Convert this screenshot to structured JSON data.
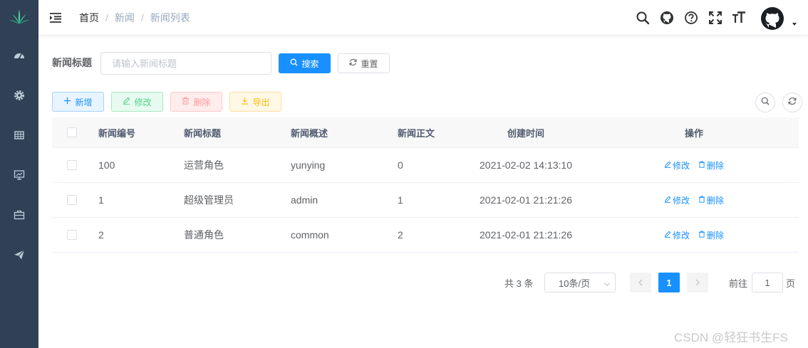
{
  "breadcrumb": [
    "首页",
    "新闻",
    "新闻列表"
  ],
  "search": {
    "label": "新闻标题",
    "placeholder": "请输入新闻标题",
    "search_label": "搜索",
    "reset_label": "重置"
  },
  "toolbar": {
    "add_label": "新增",
    "edit_label": "修改",
    "delete_label": "删除",
    "export_label": "导出"
  },
  "table": {
    "headers": [
      "新闻编号",
      "新闻标题",
      "新闻概述",
      "新闻正文",
      "创建时间",
      "操作"
    ],
    "rows": [
      {
        "id": "100",
        "title": "运营角色",
        "summary": "yunying",
        "body": "0",
        "created": "2021-02-02 14:13:10"
      },
      {
        "id": "1",
        "title": "超级管理员",
        "summary": "admin",
        "body": "1",
        "created": "2021-02-01 21:21:26"
      },
      {
        "id": "2",
        "title": "普通角色",
        "summary": "common",
        "body": "2",
        "created": "2021-02-01 21:21:26"
      }
    ],
    "row_edit_label": "修改",
    "row_delete_label": "删除"
  },
  "pagination": {
    "total_text": "共 3 条",
    "page_size": "10条/页",
    "current_page": "1",
    "goto_label": "前往",
    "goto_value": "1",
    "goto_unit": "页"
  },
  "watermark": "CSDN @轻狂书生FS",
  "colors": {
    "sidebar": "#304156",
    "primary": "#1890ff",
    "success": "#13ce66",
    "danger": "#ff4949",
    "warning": "#ffba00"
  },
  "icons": {
    "sidebar": [
      "dashboard-icon",
      "gear-icon",
      "table-icon",
      "monitor-icon",
      "briefcase-icon",
      "paper-plane-icon"
    ],
    "topbar": [
      "search-icon",
      "github-icon",
      "question-icon",
      "fullscreen-icon",
      "font-size-icon"
    ]
  }
}
